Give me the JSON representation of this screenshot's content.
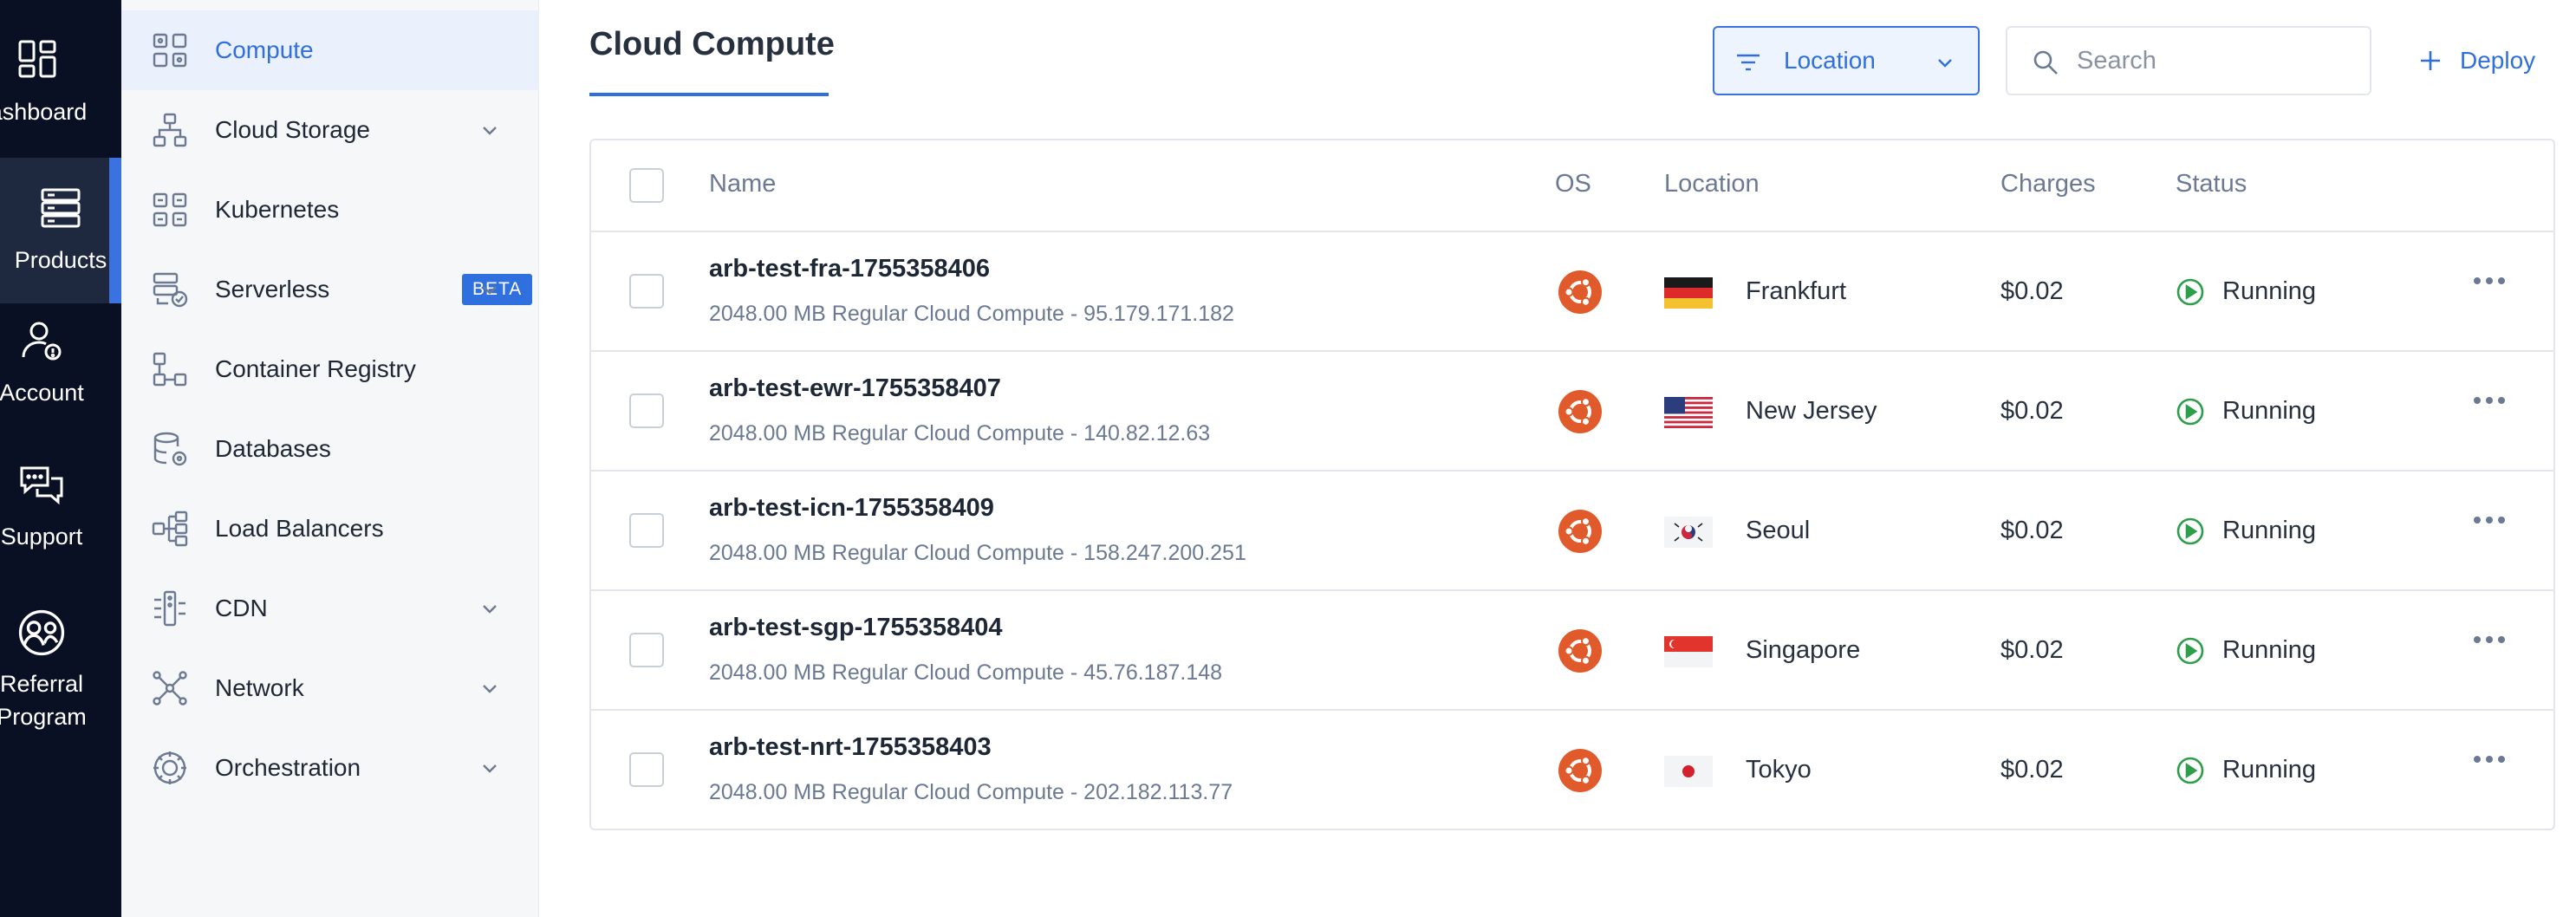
{
  "rail": {
    "items": [
      {
        "label": "ashboard",
        "icon": "dashboard-icon"
      },
      {
        "label": "Products",
        "icon": "products-icon",
        "active": true
      },
      {
        "label": "Account",
        "icon": "account-icon"
      },
      {
        "label": "Support",
        "icon": "support-icon"
      },
      {
        "label_line1": "Referral",
        "label_line2": "Program",
        "icon": "referral-icon"
      }
    ]
  },
  "sidebar": {
    "items": [
      {
        "label": "Compute",
        "icon": "compute-icon",
        "active": true
      },
      {
        "label": "Cloud Storage",
        "icon": "cloud-storage-icon",
        "expandable": true
      },
      {
        "label": "Kubernetes",
        "icon": "kubernetes-icon"
      },
      {
        "label": "Serverless",
        "icon": "serverless-icon",
        "badge": "BETA",
        "expandable": true
      },
      {
        "label": "Container Registry",
        "icon": "container-registry-icon"
      },
      {
        "label": "Databases",
        "icon": "databases-icon"
      },
      {
        "label": "Load Balancers",
        "icon": "load-balancers-icon"
      },
      {
        "label": "CDN",
        "icon": "cdn-icon",
        "expandable": true
      },
      {
        "label": "Network",
        "icon": "network-icon",
        "expandable": true
      },
      {
        "label": "Orchestration",
        "icon": "orchestration-icon",
        "expandable": true
      }
    ]
  },
  "header": {
    "title": "Cloud Compute",
    "location_filter": "Location",
    "search_placeholder": "Search",
    "deploy_label": "Deploy"
  },
  "table": {
    "columns": {
      "name": "Name",
      "os": "OS",
      "location": "Location",
      "charges": "Charges",
      "status": "Status"
    },
    "rows": [
      {
        "name": "arb-test-fra-1755358406",
        "description": "2048.00 MB Regular Cloud Compute - 95.179.171.182",
        "location": "Frankfurt",
        "flag": "germany-flag",
        "charges": "$0.02",
        "status": "Running"
      },
      {
        "name": "arb-test-ewr-1755358407",
        "description": "2048.00 MB Regular Cloud Compute - 140.82.12.63",
        "location": "New Jersey",
        "flag": "usa-flag",
        "charges": "$0.02",
        "status": "Running"
      },
      {
        "name": "arb-test-icn-1755358409",
        "description": "2048.00 MB Regular Cloud Compute - 158.247.200.251",
        "location": "Seoul",
        "flag": "south-korea-flag",
        "charges": "$0.02",
        "status": "Running"
      },
      {
        "name": "arb-test-sgp-1755358404",
        "description": "2048.00 MB Regular Cloud Compute - 45.76.187.148",
        "location": "Singapore",
        "flag": "singapore-flag",
        "charges": "$0.02",
        "status": "Running"
      },
      {
        "name": "arb-test-nrt-1755358403",
        "description": "2048.00 MB Regular Cloud Compute - 202.182.113.77",
        "location": "Tokyo",
        "flag": "japan-flag",
        "charges": "$0.02",
        "status": "Running"
      }
    ]
  },
  "colors": {
    "rail_bg": "#0a1024",
    "accent": "#2f6fde",
    "ubuntu_orange": "#e05a2b",
    "running_green": "#2e9e4a"
  }
}
